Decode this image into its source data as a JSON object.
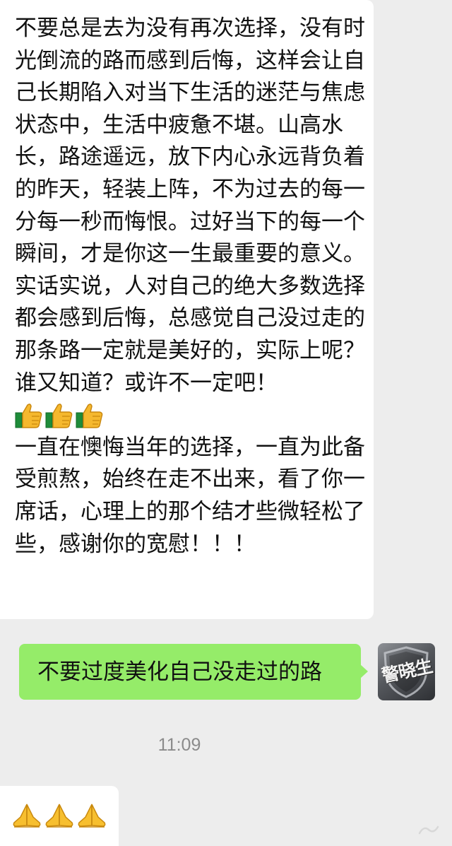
{
  "messages": [
    {
      "direction": "incoming",
      "paragraph_1": "不要总是去为没有再次选择，没有时光倒流的路而感到后悔，这样会让自己长期陷入对当下生活的迷茫与焦虑状态中，生活中疲惫不堪。山高水长，路途遥远，放下内心永远背负着的昨天，轻装上阵，不为过去的每一分每一秒而悔恨。过好当下的每一个瞬间，才是你这一生最重要的意义。实话实说，人对自己的绝大多数选择都会感到后悔，总感觉自己没过走的那条路一定就是美好的，实际上呢？谁又知道？或许不一定吧！",
      "emoji_row": [
        "thumbs-up",
        "thumbs-up",
        "thumbs-up"
      ],
      "paragraph_2": "一直在懊悔当年的选择，一直为此备受煎熬，始终在走不出来，看了你一席话，心理上的那个结才些微轻松了些，感谢你的宽慰！！！"
    },
    {
      "direction": "outgoing",
      "text": "不要过度美化自己没走过的路",
      "avatar_text": "警晓生"
    },
    {
      "timestamp": "11:09"
    },
    {
      "direction": "incoming",
      "emoji_row": [
        "folded-hands",
        "folded-hands",
        "folded-hands"
      ]
    }
  ],
  "colors": {
    "background": "#ededed",
    "incoming_bubble": "#ffffff",
    "outgoing_bubble": "#95ec69",
    "text": "#111111",
    "timestamp": "#8b8b8b"
  }
}
